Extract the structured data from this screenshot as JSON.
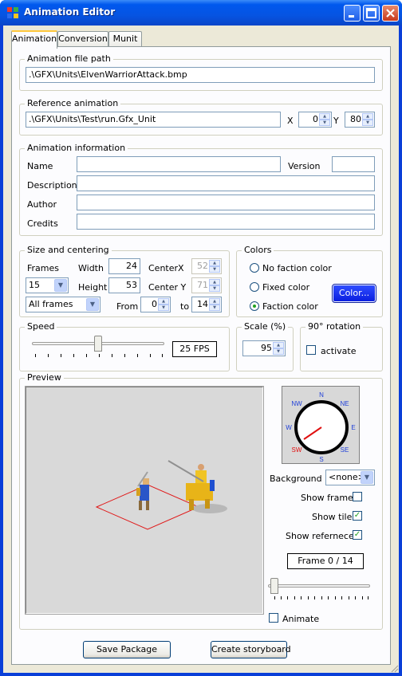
{
  "window": {
    "title": "Animation Editor"
  },
  "tabs": [
    "Animation",
    "Conversion",
    "Munit"
  ],
  "file_path": {
    "caption": "Animation file path",
    "value": ".\\GFX\\Units\\ElvenWarriorAttack.bmp"
  },
  "reference": {
    "caption": "Reference animation",
    "value": ".\\GFX\\Units\\Test\\run.Gfx_Unit",
    "x_label": "X",
    "x_value": "0",
    "y_label": "Y",
    "y_value": "80"
  },
  "info": {
    "caption": "Animation information",
    "name_label": "Name",
    "version_label": "Version",
    "description_label": "Description",
    "author_label": "Author",
    "credits_label": "Credits"
  },
  "size": {
    "caption": "Size and centering",
    "frames_label": "Frames",
    "frames_value": "15",
    "frame_mode": "All frames",
    "width_label": "Width",
    "width_value": "24",
    "height_label": "Height",
    "height_value": "53",
    "centerx_label": "CenterX",
    "centerx_value": "52",
    "centery_label": "Center Y",
    "centery_value": "71",
    "from_label": "From",
    "from_value": "0",
    "to_label": "to",
    "to_value": "14"
  },
  "colors": {
    "caption": "Colors",
    "options": [
      "No faction color",
      "Fixed color",
      "Faction color"
    ],
    "selected": 2,
    "button": "Color...",
    "button_color": "#1a2cf0"
  },
  "speed": {
    "caption": "Speed",
    "value": "25 FPS"
  },
  "scale": {
    "caption": "Scale (%)",
    "value": "95"
  },
  "rotation": {
    "caption": "90° rotation",
    "label": "activate",
    "checked": false
  },
  "preview": {
    "caption": "Preview",
    "background_label": "Background",
    "background_value": "<none>",
    "show_frame": "Show frame",
    "show_frame_checked": false,
    "show_tile": "Show tile",
    "show_tile_checked": true,
    "show_reference": "Show refernece",
    "show_reference_checked": true,
    "frame_counter": "Frame 0 / 14",
    "animate": "Animate",
    "animate_checked": false
  },
  "compass": {
    "labels": [
      "N",
      "NE",
      "E",
      "SE",
      "S",
      "SW",
      "W",
      "NW"
    ],
    "active": "SW",
    "active_color": "#e01010",
    "label_color": "#1f3fd8"
  },
  "buttons": {
    "save": "Save Package",
    "storyboard": "Create storyboard"
  }
}
